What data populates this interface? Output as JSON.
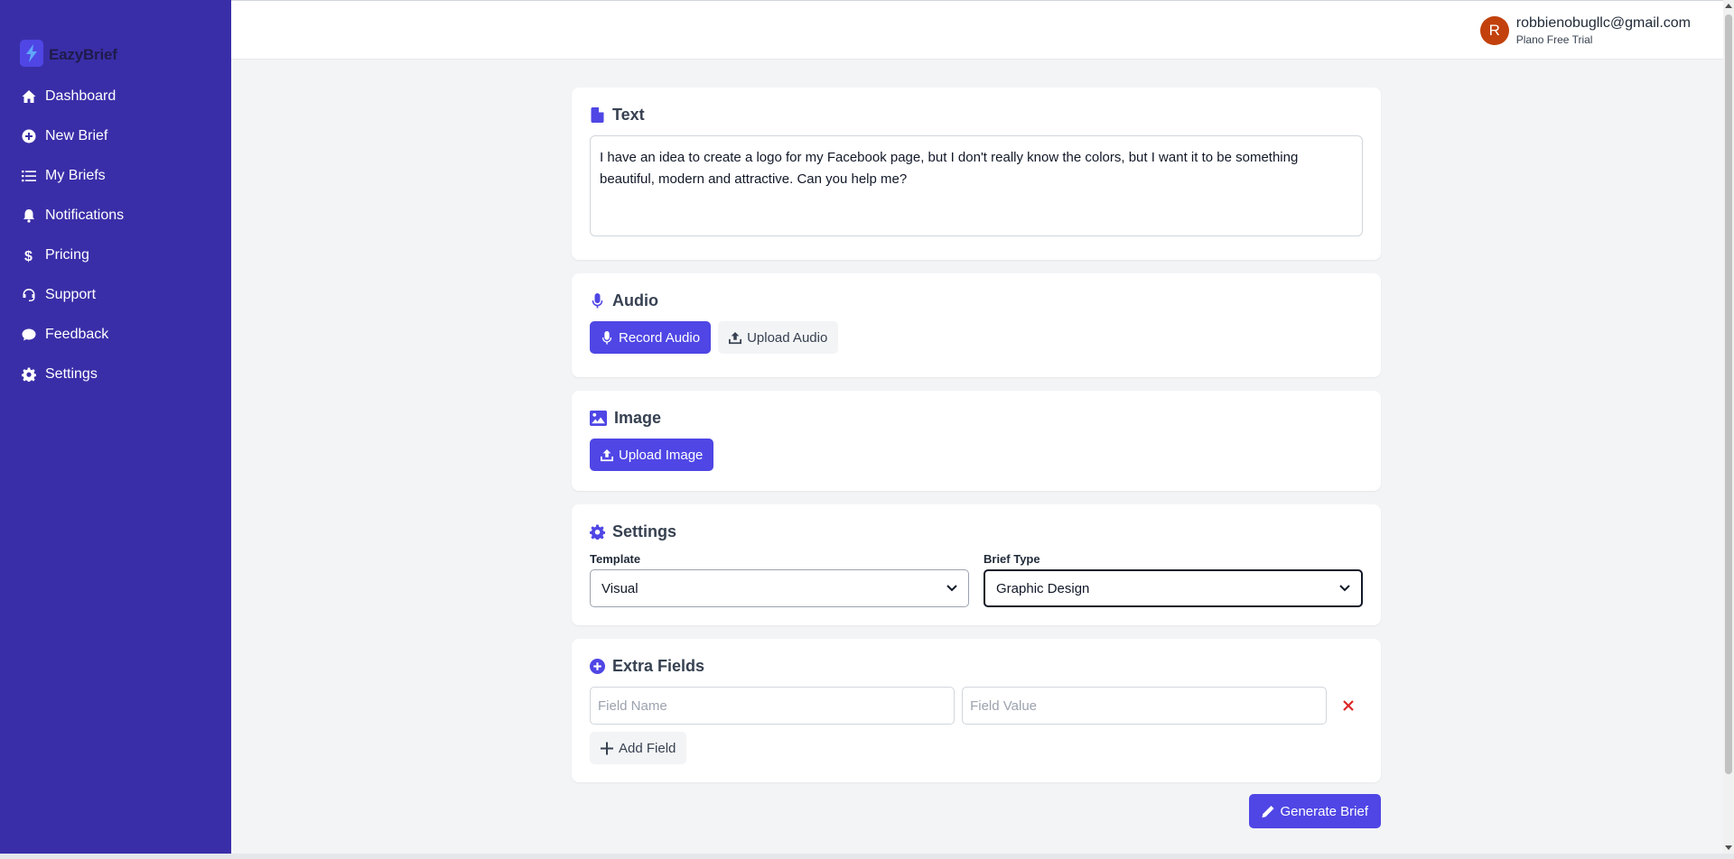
{
  "app": {
    "name": "EazyBrief"
  },
  "sidebar": {
    "items": [
      {
        "label": "Dashboard",
        "icon": "home-icon"
      },
      {
        "label": "New Brief",
        "icon": "plus-circle-icon"
      },
      {
        "label": "My Briefs",
        "icon": "list-icon"
      },
      {
        "label": "Notifications",
        "icon": "bell-icon"
      },
      {
        "label": "Pricing",
        "icon": "dollar-icon"
      },
      {
        "label": "Support",
        "icon": "headset-icon"
      },
      {
        "label": "Feedback",
        "icon": "comment-icon"
      },
      {
        "label": "Settings",
        "icon": "gear-icon"
      }
    ]
  },
  "header": {
    "user": {
      "initial": "R",
      "email": "robbienobugllc@gmail.com",
      "plan": "Plano Free Trial"
    }
  },
  "text_section": {
    "title": "Text",
    "content": "I have an idea to create a logo for my Facebook page, but I don't really know the colors, but I want it to be something beautiful, modern and attractive. Can you help me?"
  },
  "audio_section": {
    "title": "Audio",
    "record_label": "Record Audio",
    "upload_label": "Upload Audio"
  },
  "image_section": {
    "title": "Image",
    "upload_label": "Upload Image"
  },
  "settings_section": {
    "title": "Settings",
    "template_label": "Template",
    "template_value": "Visual",
    "brief_type_label": "Brief Type",
    "brief_type_value": "Graphic Design"
  },
  "extra_fields": {
    "title": "Extra Fields",
    "name_placeholder": "Field Name",
    "value_placeholder": "Field Value",
    "add_label": "Add Field"
  },
  "actions": {
    "generate_label": "Generate Brief"
  },
  "colors": {
    "sidebar": "#3a2ea8",
    "primary": "#4f46e5",
    "remove": "#dc2626",
    "avatar": "#c2410c"
  }
}
